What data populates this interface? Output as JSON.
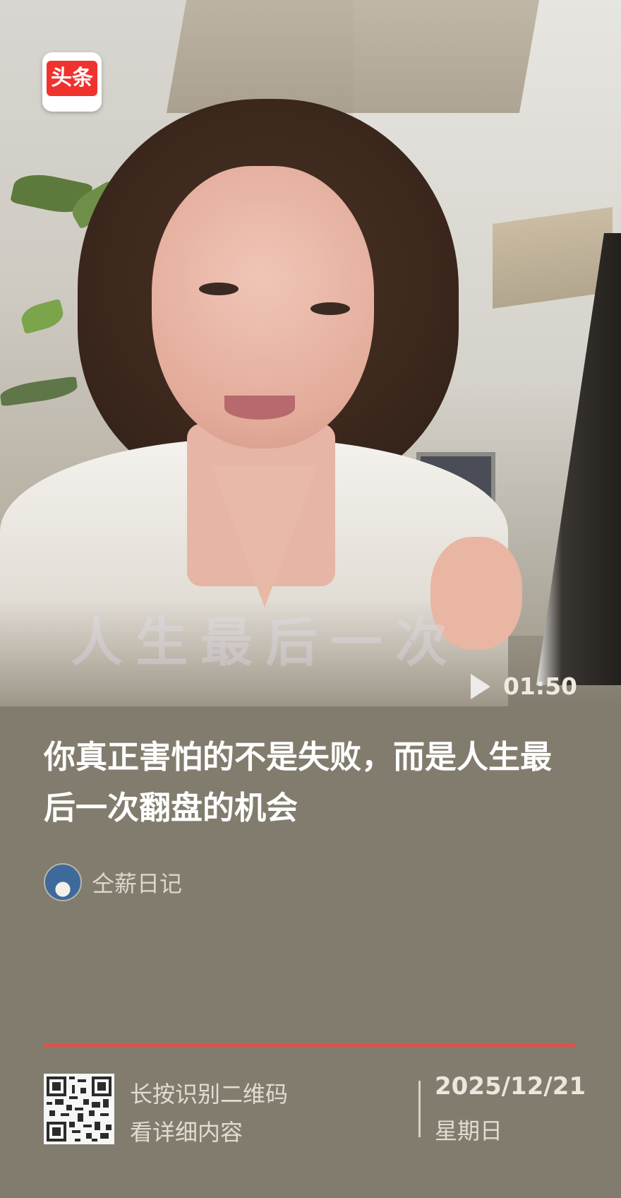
{
  "logo": {
    "text": "头条"
  },
  "video": {
    "overlay_caption": "人生最后一次",
    "duration": "01:50"
  },
  "article": {
    "title": "你真正害怕的不是失败，而是人生最后一次翻盘的机会",
    "author": "仝薪日记"
  },
  "footer": {
    "qr_line1": "长按识别二维码",
    "qr_line2": "看详细内容",
    "date": "2025/12/21",
    "weekday": "星期日"
  },
  "colors": {
    "background": "#827c6e",
    "divider": "#df5146",
    "logo_red": "#f0322f"
  },
  "icons": [
    "play-icon",
    "qr-code-icon",
    "author-avatar"
  ]
}
